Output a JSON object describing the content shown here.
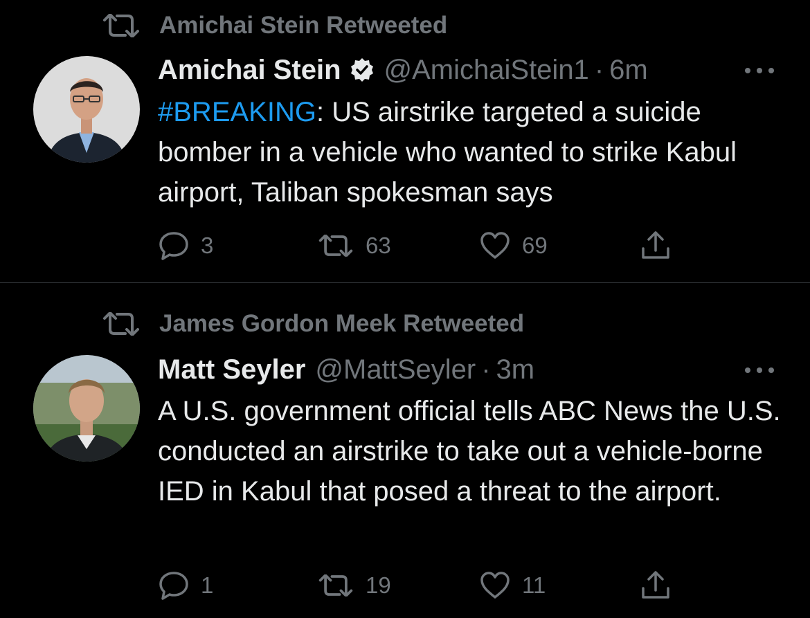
{
  "tweets": [
    {
      "retweeted_by": "Amichai Stein Retweeted",
      "author_name": "Amichai Stein",
      "verified": true,
      "handle": "@AmichaiStein1",
      "time": "6m",
      "hashtag": "#BREAKING",
      "text": ": US airstrike targeted a suicide bomber in a vehicle who wanted to strike Kabul airport, Taliban spokesman says",
      "replies": "3",
      "retweets": "63",
      "likes": "69"
    },
    {
      "retweeted_by": "James Gordon Meek Retweeted",
      "author_name": "Matt Seyler",
      "verified": false,
      "handle": "@MattSeyler",
      "time": "3m",
      "text": "A U.S. government official tells ABC News the U.S. conducted an airstrike to take out a vehicle-borne IED in Kabul that posed a threat to the airport.",
      "replies": "1",
      "retweets": "19",
      "likes": "11"
    }
  ],
  "separator": "·",
  "icons": {
    "retweeted_indicator": "retweet-icon",
    "verified": "verified-badge-icon",
    "more": "more-options-icon",
    "reply": "reply-icon",
    "retweet": "retweet-icon",
    "like": "heart-icon",
    "share": "share-icon"
  },
  "colors": {
    "background": "#000000",
    "text": "#e7e9ea",
    "secondary": "#71767b",
    "hashtag": "#1d9bf0",
    "divider": "#2f3336"
  }
}
